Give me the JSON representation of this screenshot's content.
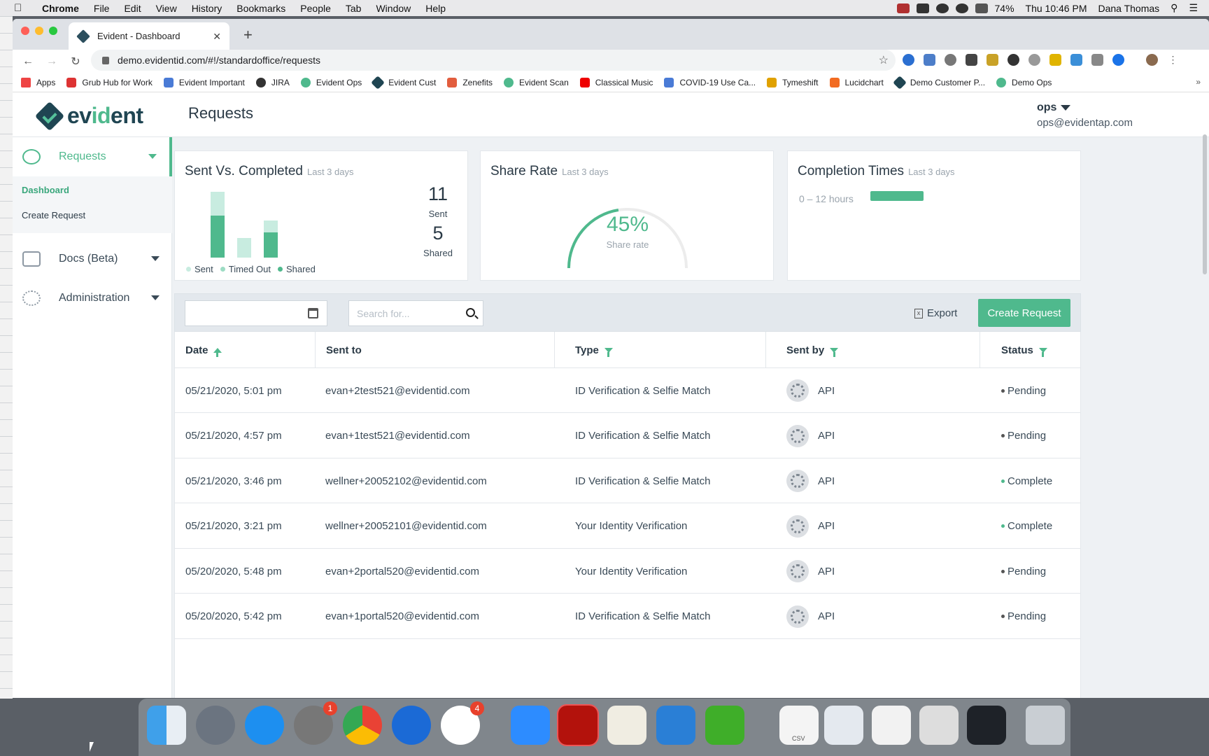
{
  "menubar": {
    "app": "Chrome",
    "items": [
      "File",
      "Edit",
      "View",
      "History",
      "Bookmarks",
      "People",
      "Tab",
      "Window",
      "Help"
    ],
    "battery": "74%",
    "clock": "Thu 10:46 PM",
    "user": "Dana Thomas"
  },
  "browser": {
    "tab_title": "Evident - Dashboard",
    "url": "demo.evidentid.com/#!/standardoffice/requests",
    "bookmarks": [
      "Apps",
      "Grub Hub for Work",
      "Evident Important",
      "JIRA",
      "Evident Ops",
      "Evident Cust",
      "Zenefits",
      "Evident Scan",
      "Classical Music",
      "COVID-19 Use Ca...",
      "Tymeshift",
      "Lucidchart",
      "Demo Customer P...",
      "Demo Ops"
    ]
  },
  "app": {
    "logo_prefix": "ev",
    "logo_mid": "id",
    "logo_suffix": "ent",
    "page_title": "Requests",
    "user_name": "ops",
    "user_email": "ops@evidentap.com"
  },
  "sidebar": {
    "requests": "Requests",
    "dashboard": "Dashboard",
    "create_request": "Create Request",
    "docs": "Docs (Beta)",
    "administration": "Administration"
  },
  "cards": {
    "sent_title": "Sent Vs. Completed",
    "sent_period": "Last 3 days",
    "sent_count": "11",
    "sent_label": "Sent",
    "shared_count": "5",
    "shared_label": "Shared",
    "legend": [
      "Sent",
      "Timed Out",
      "Shared"
    ],
    "share_title": "Share Rate",
    "share_period": "Last 3 days",
    "share_value": "45%",
    "share_label": "Share rate",
    "completion_title": "Completion Times",
    "completion_period": "Last 3 days",
    "completion_bucket": "0 – 12 hours"
  },
  "chart_data": {
    "type": "bar",
    "bars": [
      {
        "sent": 9,
        "shared": 5,
        "timed_out": 0
      },
      {
        "sent": 1,
        "shared": 0,
        "timed_out": 1
      },
      {
        "sent": 5,
        "shared": 3,
        "timed_out": 0
      }
    ],
    "share_rate": 0.45,
    "completion_fraction": 1.0
  },
  "toolbar": {
    "search_placeholder": "Search for...",
    "export": "Export",
    "create": "Create Request"
  },
  "table": {
    "headers": [
      "Date",
      "Sent to",
      "Type",
      "Sent by",
      "Status"
    ],
    "rows": [
      {
        "date": "05/21/2020, 5:01 pm",
        "to": "evan+2test521@evidentid.com",
        "type": "ID Verification & Selfie Match",
        "by": "API",
        "status": "Pending"
      },
      {
        "date": "05/21/2020, 4:57 pm",
        "to": "evan+1test521@evidentid.com",
        "type": "ID Verification & Selfie Match",
        "by": "API",
        "status": "Pending"
      },
      {
        "date": "05/21/2020, 3:46 pm",
        "to": "wellner+20052102@evidentid.com",
        "type": "ID Verification & Selfie Match",
        "by": "API",
        "status": "Complete"
      },
      {
        "date": "05/21/2020, 3:21 pm",
        "to": "wellner+20052101@evidentid.com",
        "type": "Your Identity Verification",
        "by": "API",
        "status": "Complete"
      },
      {
        "date": "05/20/2020, 5:48 pm",
        "to": "evan+2portal520@evidentid.com",
        "type": "Your Identity Verification",
        "by": "API",
        "status": "Pending"
      },
      {
        "date": "05/20/2020, 5:42 pm",
        "to": "evan+1portal520@evidentid.com",
        "type": "ID Verification & Selfie Match",
        "by": "API",
        "status": "Pending"
      }
    ]
  },
  "colors": {
    "accent": "#4fb98d",
    "light_accent": "#c8ece0",
    "dark": "#1f4552",
    "pending": "#555555",
    "complete": "#4fb98d"
  },
  "dock": {
    "badges": [
      "1",
      "4"
    ],
    "file_label": "CSV"
  }
}
